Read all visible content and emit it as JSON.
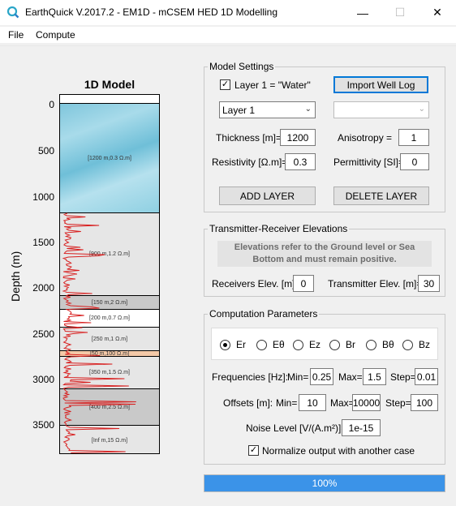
{
  "window": {
    "title": "EarthQuick V.2017.2 - EM1D - mCSEM HED 1D Modelling",
    "minimize_glyph": "—",
    "maximize_glyph": "☐",
    "close_glyph": "✕"
  },
  "menu": {
    "items": [
      "File",
      "Compute"
    ]
  },
  "model": {
    "title": "1D Model",
    "y_axis_label": "Depth (m)",
    "depth_ticks": [
      "0",
      "500",
      "1000",
      "1500",
      "2000",
      "2500",
      "3000",
      "3500"
    ],
    "layers": [
      {
        "label": "[1200 m,0.3 Ω.m]",
        "kind": "water"
      },
      {
        "label": "[900 m,1.2 Ω.m]",
        "kind": "gray1"
      },
      {
        "label": "[150 m,2 Ω.m]",
        "kind": "gray2"
      },
      {
        "label": "[200 m,0.7 Ω.m]",
        "kind": "white"
      },
      {
        "label": "[250 m,1 Ω.m]",
        "kind": "gray1"
      },
      {
        "label": "[50 m,100 Ω.m]",
        "kind": "orange"
      },
      {
        "label": "[350 m,1.5 Ω.m]",
        "kind": "gray1"
      },
      {
        "label": "[400 m,2.5 Ω.m]",
        "kind": "gray2"
      },
      {
        "label": "[Inf m,15 Ω.m]",
        "kind": "gray1"
      }
    ],
    "well_log_color": "#d82020"
  },
  "model_settings": {
    "group_title": "Model Settings",
    "water_checkbox_label": "Layer 1 = \"Water\"",
    "water_checked": true,
    "import_button": "Import Well Log",
    "layer_select": "Layer 1",
    "secondary_select": "",
    "thickness_label": "Thickness [m]=",
    "thickness_value": "1200",
    "anisotropy_label": "Anisotropy =",
    "anisotropy_value": "1",
    "resistivity_label": "Resistivity [Ω.m]=",
    "resistivity_value": "0.3",
    "permittivity_label": "Permittivity [SI]=",
    "permittivity_value": "0",
    "add_button": "ADD LAYER",
    "delete_button": "DELETE LAYER"
  },
  "tr_elevations": {
    "group_title": "Transmitter-Receiver Elevations",
    "note": "Elevations refer to the Ground level or Sea Bottom and must remain positive.",
    "receivers_label": "Receivers Elev. [m]=",
    "receivers_value": "0",
    "transmitter_label": "Transmitter Elev. [m]=",
    "transmitter_value": "30"
  },
  "computation": {
    "group_title": "Computation Parameters",
    "components": [
      "Er",
      "Eθ",
      "Ez",
      "Br",
      "Bθ",
      "Bz"
    ],
    "selected_component": "Er",
    "frequencies_label": "Frequencies [Hz]:",
    "min_label": "Min=",
    "max_label": "Max=",
    "step_label": "Step=",
    "freq_min": "0.25",
    "freq_max": "1.5",
    "freq_step": "0.01",
    "offsets_label": "Offsets [m]:",
    "offset_min_label": "Min=",
    "offset_max_label": "Max=",
    "offset_step_label": "Step=",
    "offset_min": "10",
    "offset_max": "10000",
    "offset_step": "100",
    "noise_label": "Noise Level [V/(A.m²)]=",
    "noise_value": "1e-15",
    "normalize_label": "Normalize output with another case",
    "normalize_checked": true
  },
  "progress": {
    "percent": 100,
    "text": "100%"
  }
}
